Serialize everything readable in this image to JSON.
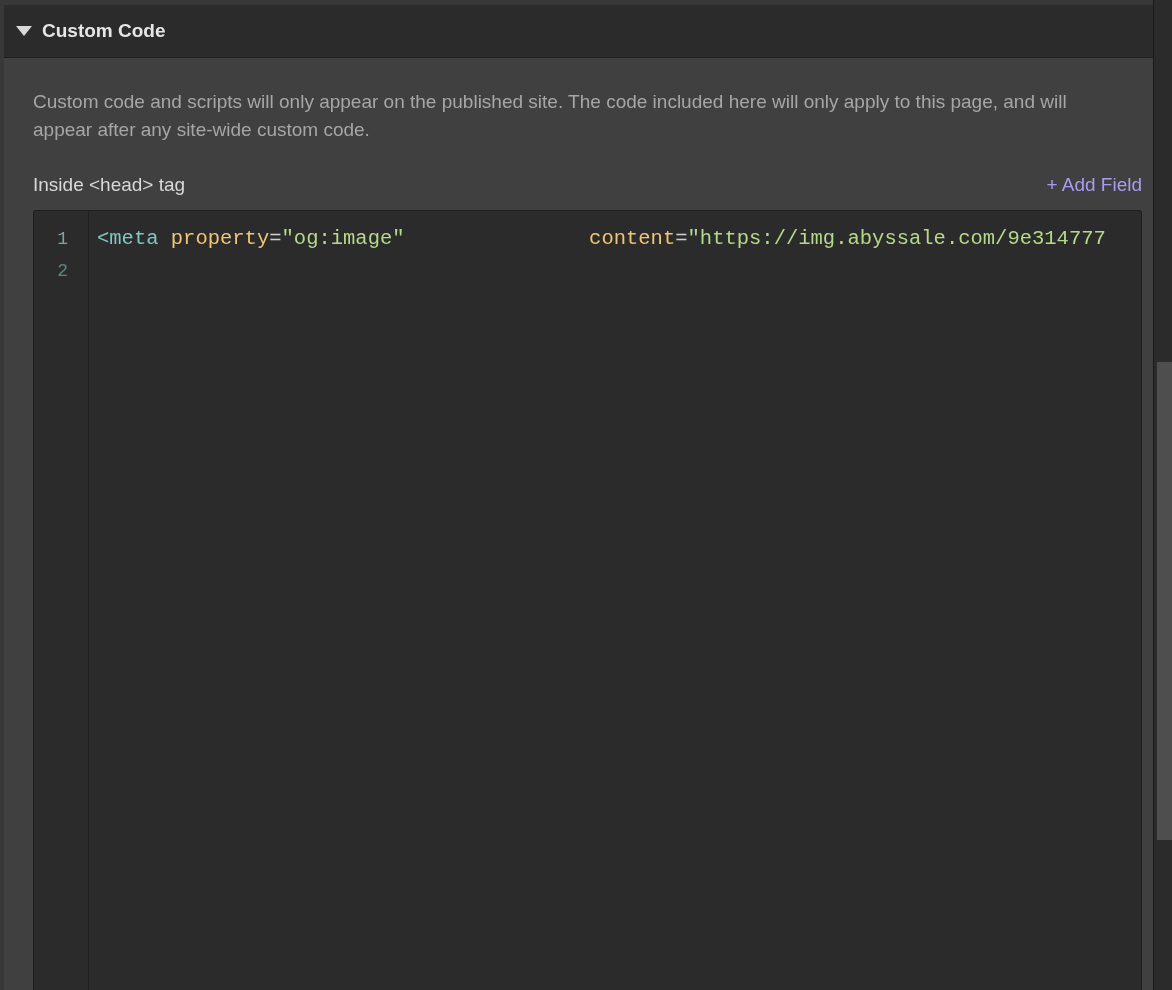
{
  "section": {
    "title": "Custom Code",
    "expanded": true
  },
  "description": "Custom code and scripts will only appear on the published site. The code included here will only apply to this page, and will appear after any site-wide custom code.",
  "field": {
    "label": "Inside <head> tag",
    "action": "+ Add Field"
  },
  "editor": {
    "lines": [
      {
        "number": "1",
        "tokens": [
          {
            "kind": "tag",
            "text": "<meta "
          },
          {
            "kind": "attr",
            "text": "property"
          },
          {
            "kind": "plain",
            "text": "="
          },
          {
            "kind": "string",
            "text": "\"og:image\"               "
          },
          {
            "kind": "attr",
            "text": "content"
          },
          {
            "kind": "plain",
            "text": "="
          },
          {
            "kind": "string",
            "text": "\"https://img.abyssale.com/9e314777"
          }
        ]
      },
      {
        "number": "2"
      }
    ]
  }
}
